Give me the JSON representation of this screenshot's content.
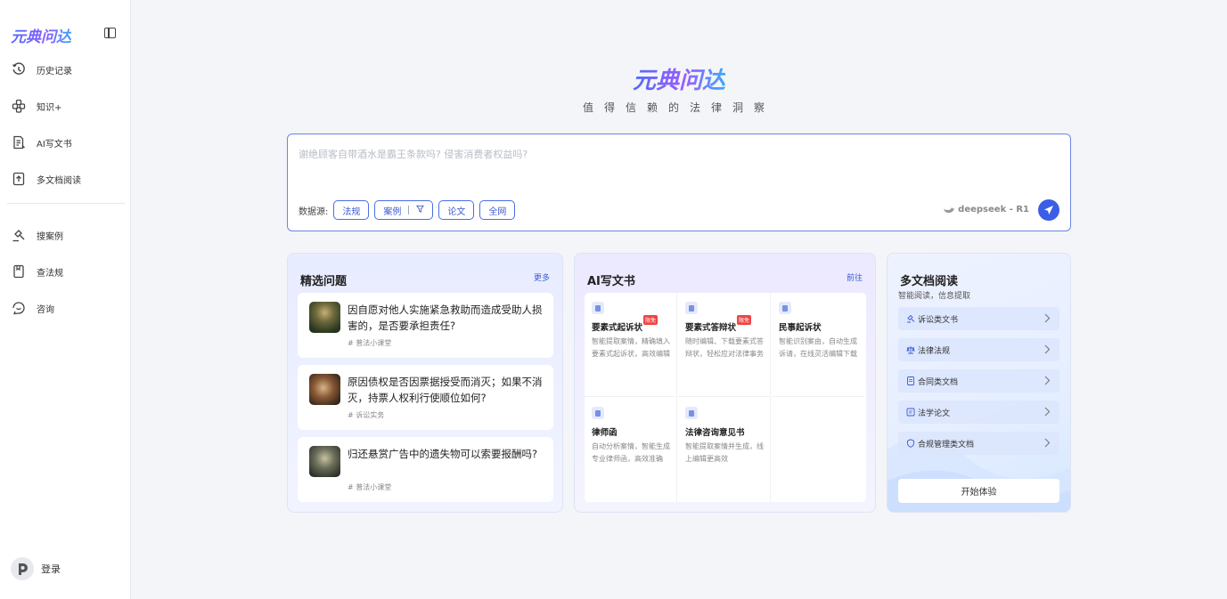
{
  "app": {
    "logo": "元典问达"
  },
  "sidebar": {
    "items": [
      {
        "label": "历史记录",
        "icon": "history-icon"
      },
      {
        "label": "知识+",
        "icon": "knowledge-icon"
      },
      {
        "label": "AI写文书",
        "icon": "document-write-icon"
      },
      {
        "label": "多文档阅读",
        "icon": "upload-doc-icon"
      },
      {
        "label": "搜案例",
        "icon": "gavel-icon"
      },
      {
        "label": "查法规",
        "icon": "law-book-icon"
      },
      {
        "label": "咨询",
        "icon": "chat-icon"
      }
    ],
    "login_label": "登录"
  },
  "hero": {
    "title": "元典问达",
    "subtitle": "值得信赖的法律洞察"
  },
  "search": {
    "placeholder": "谢绝顾客自带酒水是霸王条款吗? 侵害消费者权益吗?",
    "sources_label": "数据源:",
    "chips": [
      "法规",
      "案例",
      "论文",
      "全网"
    ],
    "model": "deepseek - R1"
  },
  "questions": {
    "title": "精选问题",
    "more": "更多",
    "items": [
      {
        "text": "因自愿对他人实施紧急救助而造成受助人损害的，是否要承担责任?",
        "tag": "# 普法小课堂"
      },
      {
        "text": "原因债权是否因票据授受而消灭；如果不消灭，持票人权利行使顺位如何?",
        "tag": "# 诉讼实务"
      },
      {
        "text": "归还悬赏广告中的遗失物可以索要报酬吗?",
        "tag": "# 普法小课堂"
      }
    ]
  },
  "ai_write": {
    "title": "AI写文书",
    "link": "前往",
    "items": [
      {
        "name": "要素式起诉状",
        "badge": "限免",
        "desc": "智能提取案情，精确填入要素式起诉状，高效编辑"
      },
      {
        "name": "要素式答辩状",
        "badge": "限免",
        "desc": "随时编辑、下载要素式答辩状，轻松应对法律事务"
      },
      {
        "name": "民事起诉状",
        "badge": "",
        "desc": "智能识别案由，自动生成诉请，在线灵活编辑下载"
      },
      {
        "name": "律师函",
        "badge": "",
        "desc": "自动分析案情，智能生成专业律师函，高效准确"
      },
      {
        "name": "法律咨询意见书",
        "badge": "",
        "desc": "智能提取案情并生成，线上编辑更高效"
      }
    ]
  },
  "multi_doc": {
    "title": "多文档阅读",
    "subtitle": "智能阅读，信息提取",
    "items": [
      {
        "label": "诉讼类文书",
        "icon": "gavel-icon"
      },
      {
        "label": "法律法规",
        "icon": "scale-icon"
      },
      {
        "label": "合同类文档",
        "icon": "contract-icon"
      },
      {
        "label": "法学论文",
        "icon": "paper-icon"
      },
      {
        "label": "合规管理类文档",
        "icon": "shield-icon"
      }
    ],
    "start_label": "开始体验"
  }
}
